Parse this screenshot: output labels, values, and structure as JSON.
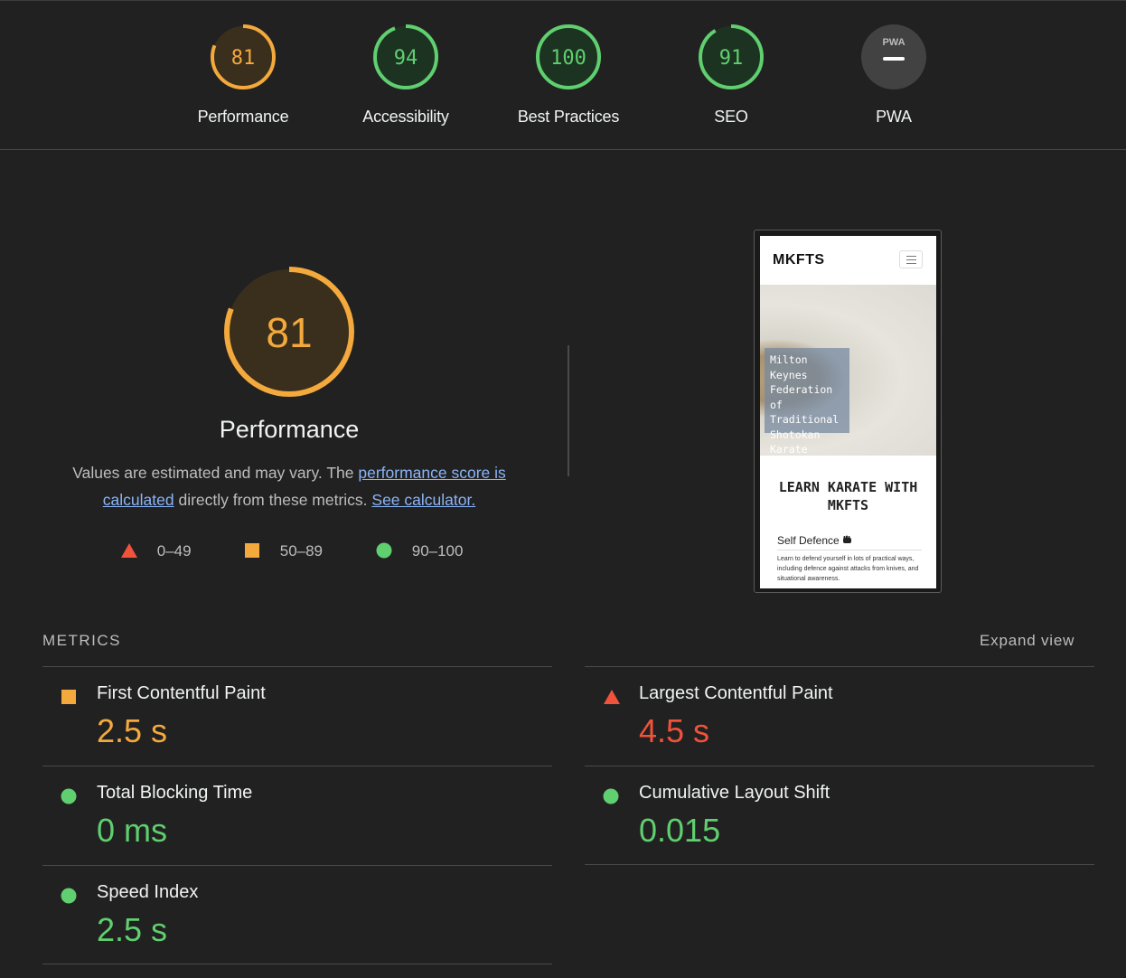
{
  "categories": [
    {
      "score": "81",
      "label": "Performance",
      "status": "average",
      "fraction": 0.81
    },
    {
      "score": "94",
      "label": "Accessibility",
      "status": "pass",
      "fraction": 0.94
    },
    {
      "score": "100",
      "label": "Best Practices",
      "status": "pass",
      "fraction": 1.0
    },
    {
      "score": "91",
      "label": "SEO",
      "status": "pass",
      "fraction": 0.91
    },
    {
      "score": "",
      "label": "PWA",
      "badge": "PWA",
      "status": "na"
    }
  ],
  "performance": {
    "score": "81",
    "fraction": 0.81,
    "title": "Performance",
    "desc_prefix": "Values are estimated and may vary. The ",
    "desc_link1": "performance score is calculated",
    "desc_middle": " directly from these metrics. ",
    "desc_link2": "See calculator.",
    "legend": [
      "0–49",
      "50–89",
      "90–100"
    ]
  },
  "screenshot": {
    "logo": "MKFTS",
    "hero_text": "Milton Keynes\nFederation of\nTraditional\nShotokan\nKarate Clubs",
    "heading": "LEARN KARATE WITH MKFTS",
    "subheading": "Self Defence",
    "subheading_icon": "fist-icon",
    "body": "Learn to defend yourself in lots of practical ways, including defence against attacks from knives, and situational awareness."
  },
  "metrics": {
    "header": "METRICS",
    "expand_label": "Expand view",
    "items": [
      {
        "name": "First Contentful Paint",
        "value": "2.5 s",
        "status": "average"
      },
      {
        "name": "Largest Contentful Paint",
        "value": "4.5 s",
        "status": "fail"
      },
      {
        "name": "Total Blocking Time",
        "value": "0 ms",
        "status": "pass"
      },
      {
        "name": "Cumulative Layout Shift",
        "value": "0.015",
        "status": "pass"
      },
      {
        "name": "Speed Index",
        "value": "2.5 s",
        "status": "pass"
      }
    ]
  },
  "colors": {
    "pass": "#5fcf6f",
    "average": "#f4a93d",
    "fail": "#f0523b",
    "na": "#5a5a5a"
  }
}
